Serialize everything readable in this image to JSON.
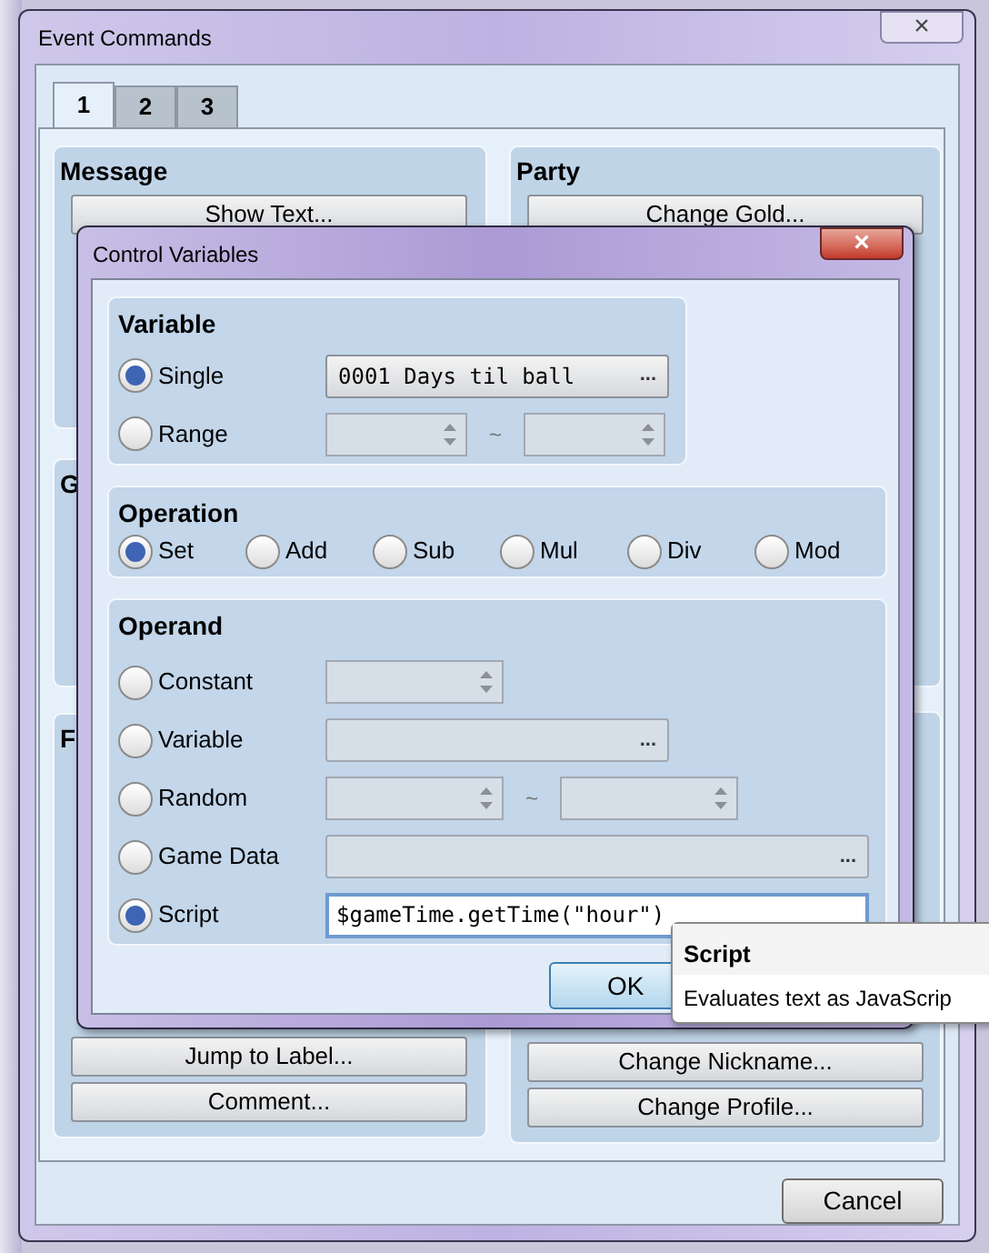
{
  "window": {
    "title": "Event Commands",
    "close": "×",
    "tabs": [
      {
        "label": "1",
        "selected": true
      },
      {
        "label": "2",
        "selected": false
      },
      {
        "label": "3",
        "selected": false
      }
    ],
    "left_groups": [
      {
        "title": "Message",
        "buttons": [
          "Show Text..."
        ]
      },
      {
        "title": "G"
      },
      {
        "title": "F",
        "bottom_buttons": [
          "Jump to Label...",
          "Comment..."
        ]
      }
    ],
    "right_groups": [
      {
        "title": "Party",
        "buttons": [
          "Change Gold..."
        ]
      },
      {
        "bottom_buttons": [
          "Change Nickname...",
          "Change Profile..."
        ]
      }
    ],
    "cancel": "Cancel"
  },
  "dialog": {
    "title": "Control Variables",
    "close": "×",
    "variable": {
      "title": "Variable",
      "options": [
        {
          "label": "Single",
          "selected": true,
          "kind": "picker",
          "value": "0001 Days til ball",
          "more": "..."
        },
        {
          "label": "Range",
          "selected": false,
          "kind": "range",
          "separator": "~"
        }
      ]
    },
    "operation": {
      "title": "Operation",
      "options": [
        {
          "label": "Set",
          "selected": true
        },
        {
          "label": "Add",
          "selected": false
        },
        {
          "label": "Sub",
          "selected": false
        },
        {
          "label": "Mul",
          "selected": false
        },
        {
          "label": "Div",
          "selected": false
        },
        {
          "label": "Mod",
          "selected": false
        }
      ]
    },
    "operand": {
      "title": "Operand",
      "options": [
        {
          "label": "Constant",
          "selected": false,
          "kind": "spin"
        },
        {
          "label": "Variable",
          "selected": false,
          "kind": "picker",
          "more": "..."
        },
        {
          "label": "Random",
          "selected": false,
          "kind": "range",
          "separator": "~"
        },
        {
          "label": "Game Data",
          "selected": false,
          "kind": "wide_picker",
          "more": "..."
        },
        {
          "label": "Script",
          "selected": true,
          "kind": "text",
          "value": "$gameTime.getTime(\"hour\")"
        }
      ]
    },
    "ok": "OK"
  },
  "tooltip": {
    "title": "Script",
    "text": "Evaluates text as JavaScrip"
  }
}
